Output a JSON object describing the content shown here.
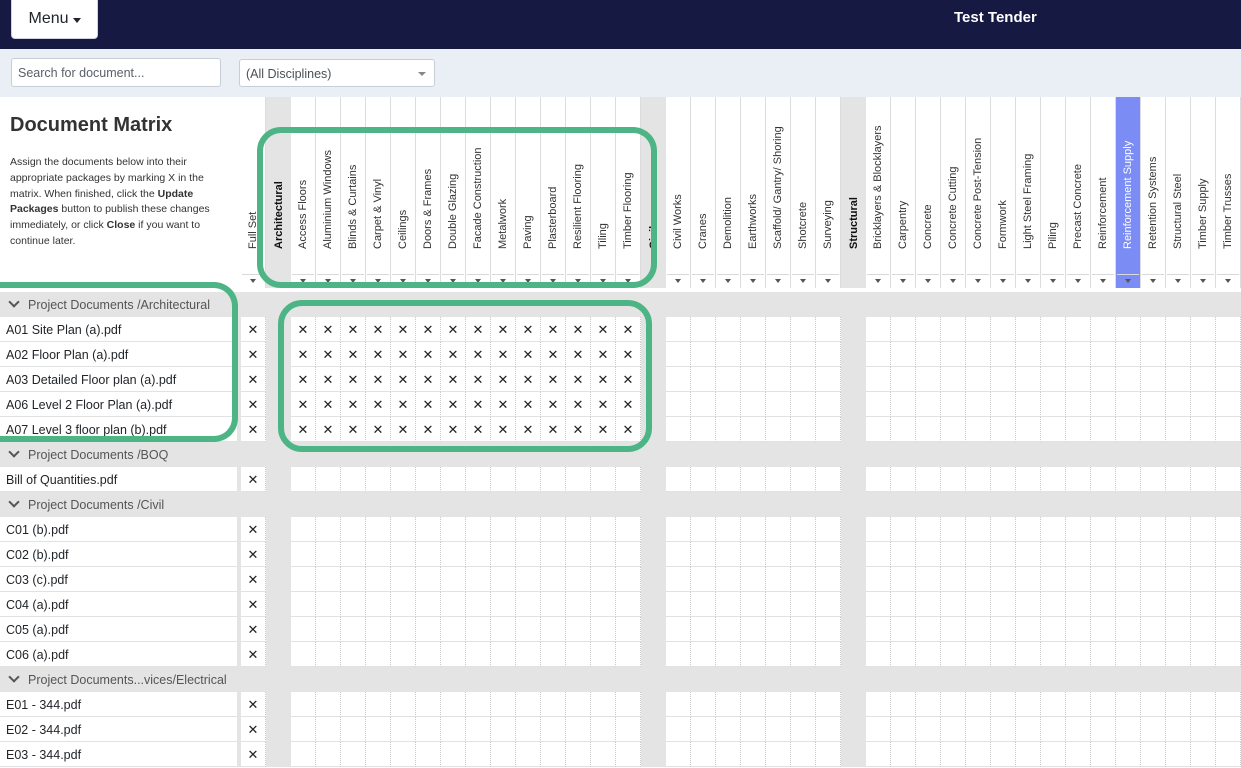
{
  "header": {
    "menu_label": "Menu",
    "app_title": "Test Tender"
  },
  "filters": {
    "search_placeholder": "Search for document...",
    "discipline_selected": "(All Disciplines)"
  },
  "info": {
    "title": "Document Matrix",
    "text_1": "Assign the documents below into their appropriate packages by marking X in the matrix. When finished, click the ",
    "update_label": "Update Packages",
    "text_2": " button to publish these changes immediately, or click ",
    "close_label": "Close",
    "text_3": " if you want to continue later."
  },
  "columns": [
    {
      "label": "Full Set",
      "type": "pkg"
    },
    {
      "label": "Architectural",
      "type": "disc"
    },
    {
      "label": "Access Floors",
      "type": "pkg"
    },
    {
      "label": "Aluminium Windows",
      "type": "pkg"
    },
    {
      "label": "Blinds & Curtains",
      "type": "pkg"
    },
    {
      "label": "Carpet & Vinyl",
      "type": "pkg"
    },
    {
      "label": "Ceilings",
      "type": "pkg"
    },
    {
      "label": "Doors & Frames",
      "type": "pkg"
    },
    {
      "label": "Double Glazing",
      "type": "pkg"
    },
    {
      "label": "Facade Construction",
      "type": "pkg"
    },
    {
      "label": "Metalwork",
      "type": "pkg"
    },
    {
      "label": "Paving",
      "type": "pkg"
    },
    {
      "label": "Plasterboard",
      "type": "pkg"
    },
    {
      "label": "Resilient Flooring",
      "type": "pkg"
    },
    {
      "label": "Tiling",
      "type": "pkg"
    },
    {
      "label": "Timber Flooring",
      "type": "pkg"
    },
    {
      "label": "Civil",
      "type": "disc"
    },
    {
      "label": "Civil Works",
      "type": "pkg"
    },
    {
      "label": "Cranes",
      "type": "pkg"
    },
    {
      "label": "Demolition",
      "type": "pkg"
    },
    {
      "label": "Earthworks",
      "type": "pkg"
    },
    {
      "label": "Scaffold/ Gantry/ Shoring",
      "type": "pkg"
    },
    {
      "label": "Shotcrete",
      "type": "pkg"
    },
    {
      "label": "Surveying",
      "type": "pkg"
    },
    {
      "label": "Structural",
      "type": "disc"
    },
    {
      "label": "Bricklayers & Blocklayers",
      "type": "pkg"
    },
    {
      "label": "Carpentry",
      "type": "pkg"
    },
    {
      "label": "Concrete",
      "type": "pkg"
    },
    {
      "label": "Concrete Cutting",
      "type": "pkg"
    },
    {
      "label": "Concrete Post-Tension",
      "type": "pkg"
    },
    {
      "label": "Formwork",
      "type": "pkg"
    },
    {
      "label": "Light Steel Framing",
      "type": "pkg"
    },
    {
      "label": "Piling",
      "type": "pkg"
    },
    {
      "label": "Precast Concrete",
      "type": "pkg"
    },
    {
      "label": "Reinforcement",
      "type": "pkg"
    },
    {
      "label": "Reinforcement Supply",
      "type": "pkg",
      "selected": true
    },
    {
      "label": "Retention Systems",
      "type": "pkg"
    },
    {
      "label": "Structural Steel",
      "type": "pkg"
    },
    {
      "label": "Timber Supply",
      "type": "pkg"
    },
    {
      "label": "Timber Trusses",
      "type": "pkg"
    }
  ],
  "mark": "✕",
  "rows": [
    {
      "type": "group",
      "label": "Project Documents /Architectural"
    },
    {
      "type": "doc",
      "label": "A01 Site Plan (a).pdf",
      "marks": "fullset+arch"
    },
    {
      "type": "doc",
      "label": "A02 Floor Plan (a).pdf",
      "marks": "fullset+arch"
    },
    {
      "type": "doc",
      "label": "A03 Detailed Floor plan (a).pdf",
      "marks": "fullset+arch"
    },
    {
      "type": "doc",
      "label": "A06 Level 2 Floor Plan (a).pdf",
      "marks": "fullset+arch"
    },
    {
      "type": "doc",
      "label": "A07 Level 3 floor plan (b).pdf",
      "marks": "fullset+arch"
    },
    {
      "type": "group",
      "label": "Project Documents /BOQ"
    },
    {
      "type": "doc",
      "label": "Bill of Quantities.pdf",
      "marks": "fullset"
    },
    {
      "type": "group",
      "label": "Project Documents /Civil"
    },
    {
      "type": "doc",
      "label": "C01 (b).pdf",
      "marks": "fullset"
    },
    {
      "type": "doc",
      "label": "C02 (b).pdf",
      "marks": "fullset"
    },
    {
      "type": "doc",
      "label": "C03 (c).pdf",
      "marks": "fullset"
    },
    {
      "type": "doc",
      "label": "C04 (a).pdf",
      "marks": "fullset"
    },
    {
      "type": "doc",
      "label": "C05 (a).pdf",
      "marks": "fullset"
    },
    {
      "type": "doc",
      "label": "C06 (a).pdf",
      "marks": "fullset"
    },
    {
      "type": "group",
      "label": "Project Documents...vices/Electrical"
    },
    {
      "type": "doc",
      "label": "E01 - 344.pdf",
      "marks": "fullset"
    },
    {
      "type": "doc",
      "label": "E02 - 344.pdf",
      "marks": "fullset"
    },
    {
      "type": "doc",
      "label": "E03 - 344.pdf",
      "marks": "fullset"
    }
  ],
  "colors": {
    "topbar": "#161a43",
    "highlight": "#4db585",
    "selected_column": "#7b8cf5",
    "group_row": "#e4e4e4"
  }
}
